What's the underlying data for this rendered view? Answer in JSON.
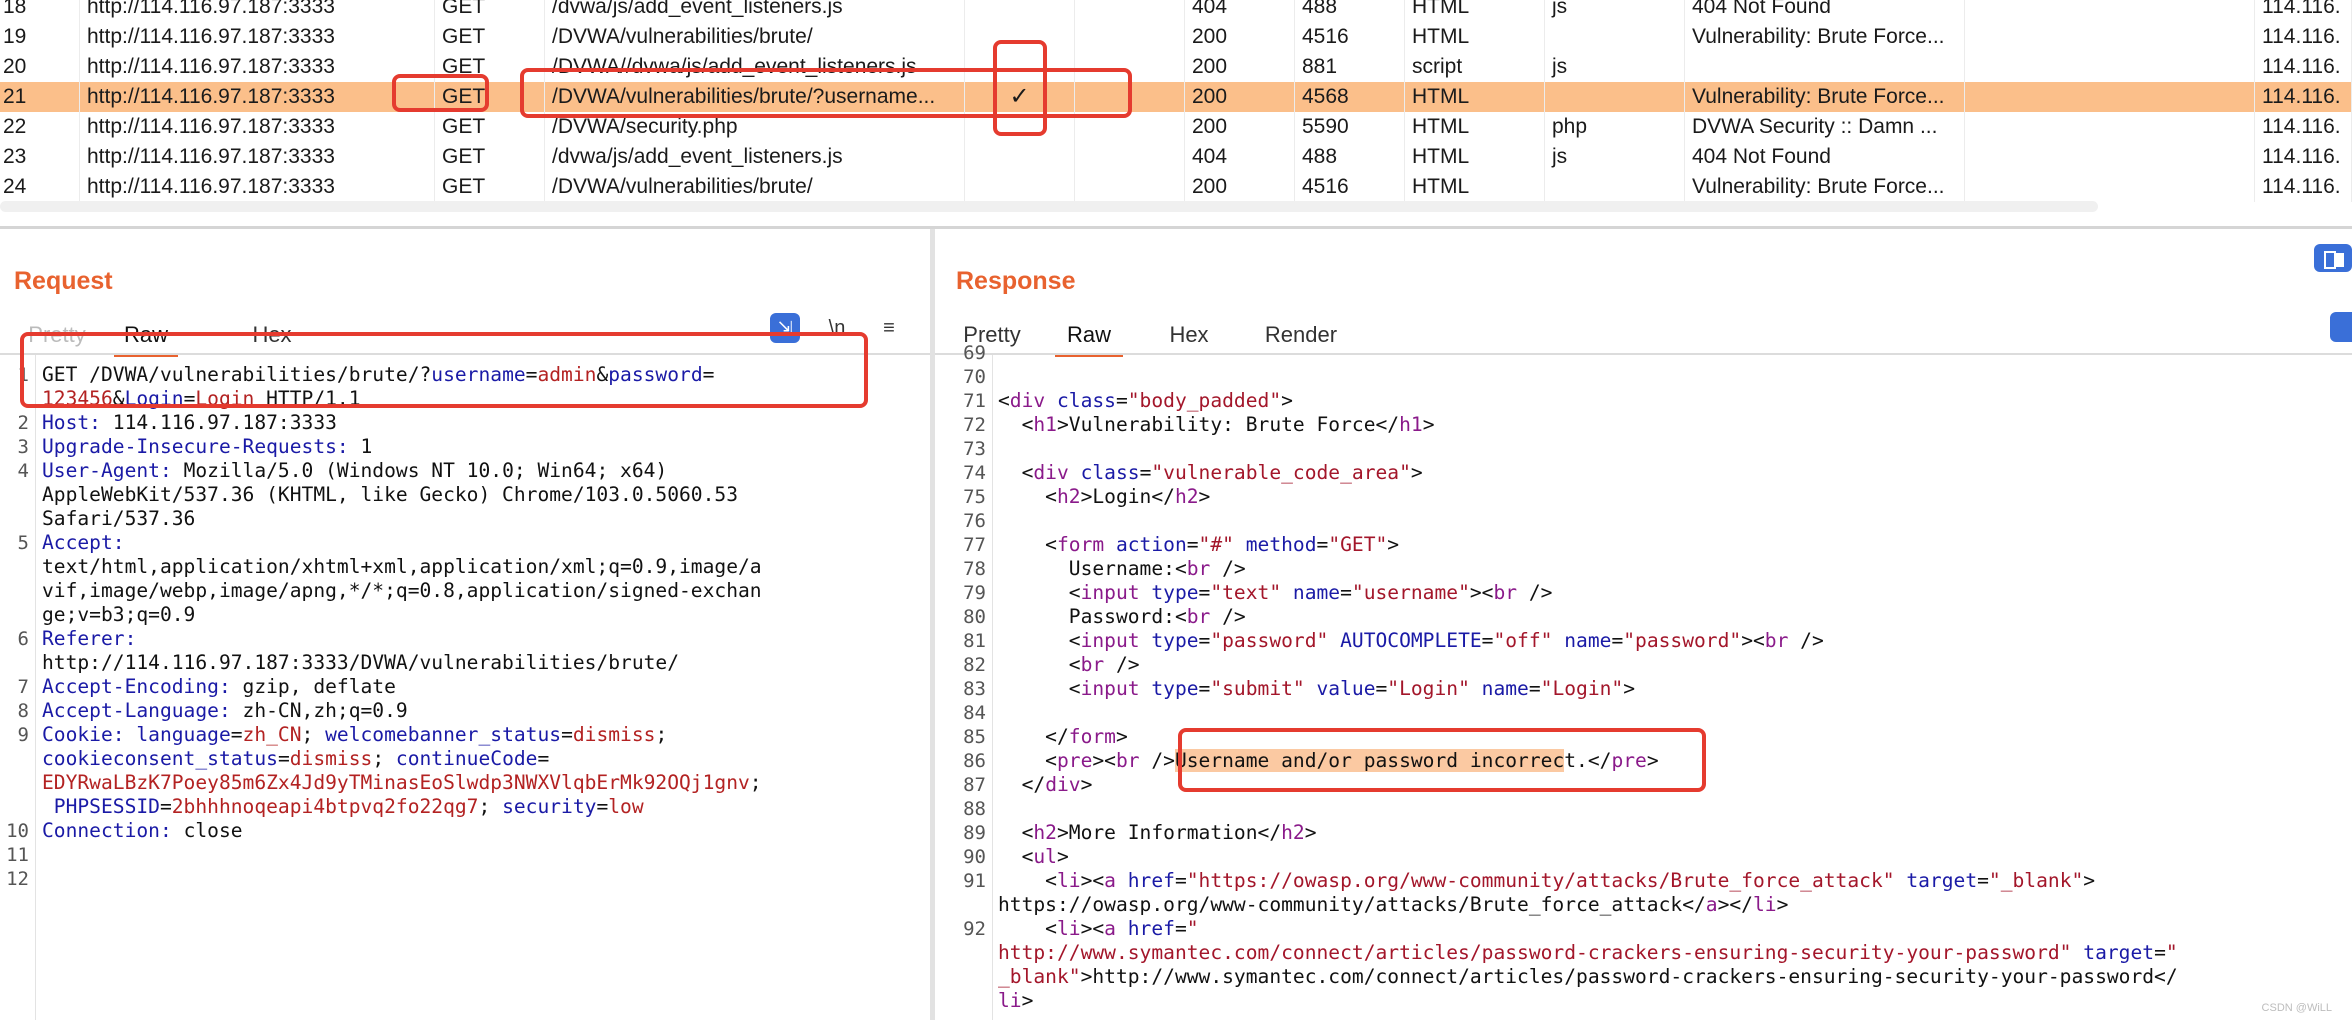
{
  "history": {
    "rows": [
      {
        "n": "18",
        "host": "http://114.116.97.187:3333",
        "method": "GET",
        "url": "/dvwa/js/add_event_listeners.js",
        "edited": "",
        "status": "404",
        "length": "488",
        "mime": "HTML",
        "ext": "js",
        "title": "404 Not Found",
        "ip": "114.116."
      },
      {
        "n": "19",
        "host": "http://114.116.97.187:3333",
        "method": "GET",
        "url": "/DVWA/vulnerabilities/brute/",
        "edited": "",
        "status": "200",
        "length": "4516",
        "mime": "HTML",
        "ext": "",
        "title": "Vulnerability: Brute Force...",
        "ip": "114.116."
      },
      {
        "n": "20",
        "host": "http://114.116.97.187:3333",
        "method": "GET",
        "url": "/DVWA//dvwa/js/add_event_listeners.js",
        "edited": "",
        "status": "200",
        "length": "881",
        "mime": "script",
        "ext": "js",
        "title": "",
        "ip": "114.116."
      },
      {
        "n": "21",
        "host": "http://114.116.97.187:3333",
        "method": "GET",
        "url": "/DVWA/vulnerabilities/brute/?username...",
        "edited": "✓",
        "status": "200",
        "length": "4568",
        "mime": "HTML",
        "ext": "",
        "title": "Vulnerability: Brute Force...",
        "ip": "114.116.",
        "selected": true
      },
      {
        "n": "22",
        "host": "http://114.116.97.187:3333",
        "method": "GET",
        "url": "/DVWA/security.php",
        "edited": "",
        "status": "200",
        "length": "5590",
        "mime": "HTML",
        "ext": "php",
        "title": "DVWA Security :: Damn ...",
        "ip": "114.116."
      },
      {
        "n": "23",
        "host": "http://114.116.97.187:3333",
        "method": "GET",
        "url": "/dvwa/js/add_event_listeners.js",
        "edited": "",
        "status": "404",
        "length": "488",
        "mime": "HTML",
        "ext": "js",
        "title": "404 Not Found",
        "ip": "114.116."
      },
      {
        "n": "24",
        "host": "http://114.116.97.187:3333",
        "method": "GET",
        "url": "/DVWA/vulnerabilities/brute/",
        "edited": "",
        "status": "200",
        "length": "4516",
        "mime": "HTML",
        "ext": "",
        "title": "Vulnerability: Brute Force...",
        "ip": "114.116."
      }
    ]
  },
  "request": {
    "title": "Request",
    "tabs": {
      "pretty": "Pretty",
      "raw": "Raw",
      "hex": "Hex"
    },
    "newline_label": "\\n",
    "menu_glyph": "≡",
    "lines": [
      {
        "n": "1",
        "parts": [
          [
            "plain",
            "GET /DVWA/vulnerabilities/brute/?"
          ],
          [
            "k",
            "username"
          ],
          [
            "plain",
            "="
          ],
          [
            "v",
            "admin"
          ],
          [
            "plain",
            "&"
          ],
          [
            "k",
            "password"
          ],
          [
            "plain",
            "="
          ]
        ]
      },
      {
        "n": "",
        "parts": [
          [
            "v",
            "123456"
          ],
          [
            "plain",
            "&"
          ],
          [
            "k",
            "Login"
          ],
          [
            "plain",
            "="
          ],
          [
            "v",
            "Login"
          ],
          [
            "plain",
            " HTTP/1.1"
          ]
        ]
      },
      {
        "n": "2",
        "parts": [
          [
            "k",
            "Host: "
          ],
          [
            "plain",
            "114.116.97.187:3333"
          ]
        ]
      },
      {
        "n": "3",
        "parts": [
          [
            "k",
            "Upgrade-Insecure-Requests: "
          ],
          [
            "plain",
            "1"
          ]
        ]
      },
      {
        "n": "4",
        "parts": [
          [
            "k",
            "User-Agent: "
          ],
          [
            "plain",
            "Mozilla/5.0 (Windows NT 10.0; Win64; x64)"
          ]
        ]
      },
      {
        "n": "",
        "parts": [
          [
            "plain",
            "AppleWebKit/537.36 (KHTML, like Gecko) Chrome/103.0.5060.53"
          ]
        ]
      },
      {
        "n": "",
        "parts": [
          [
            "plain",
            "Safari/537.36"
          ]
        ]
      },
      {
        "n": "5",
        "parts": [
          [
            "k",
            "Accept: "
          ]
        ]
      },
      {
        "n": "",
        "parts": [
          [
            "plain",
            "text/html,application/xhtml+xml,application/xml;q=0.9,image/a"
          ]
        ]
      },
      {
        "n": "",
        "parts": [
          [
            "plain",
            "vif,image/webp,image/apng,*/*;q=0.8,application/signed-exchan"
          ]
        ]
      },
      {
        "n": "",
        "parts": [
          [
            "plain",
            "ge;v=b3;q=0.9"
          ]
        ]
      },
      {
        "n": "6",
        "parts": [
          [
            "k",
            "Referer: "
          ]
        ]
      },
      {
        "n": "",
        "parts": [
          [
            "plain",
            "http://114.116.97.187:3333/DVWA/vulnerabilities/brute/"
          ]
        ]
      },
      {
        "n": "7",
        "parts": [
          [
            "k",
            "Accept-Encoding: "
          ],
          [
            "plain",
            "gzip, deflate"
          ]
        ]
      },
      {
        "n": "8",
        "parts": [
          [
            "k",
            "Accept-Language: "
          ],
          [
            "plain",
            "zh-CN,zh;q=0.9"
          ]
        ]
      },
      {
        "n": "9",
        "parts": [
          [
            "k",
            "Cookie: "
          ],
          [
            "k",
            "language"
          ],
          [
            "plain",
            "="
          ],
          [
            "v",
            "zh_CN"
          ],
          [
            "plain",
            "; "
          ],
          [
            "k",
            "welcomebanner_status"
          ],
          [
            "plain",
            "="
          ],
          [
            "v",
            "dismiss"
          ],
          [
            "plain",
            ";"
          ]
        ]
      },
      {
        "n": "",
        "parts": [
          [
            "k",
            "cookieconsent_status"
          ],
          [
            "plain",
            "="
          ],
          [
            "v",
            "dismiss"
          ],
          [
            "plain",
            "; "
          ],
          [
            "k",
            "continueCode"
          ],
          [
            "plain",
            "="
          ]
        ]
      },
      {
        "n": "",
        "parts": [
          [
            "v",
            "EDYRwaLBzK7Poey85m6Zx4Jd9yTMinasEoSlwdp3NWXVlqbErMk92OQj1gnv"
          ],
          [
            "plain",
            ";"
          ]
        ]
      },
      {
        "n": "",
        "parts": [
          [
            "plain",
            " "
          ],
          [
            "k",
            "PHPSESSID"
          ],
          [
            "plain",
            "="
          ],
          [
            "v",
            "2bhhhnoqeapi4btpvq2fo22qg7"
          ],
          [
            "plain",
            "; "
          ],
          [
            "k",
            "security"
          ],
          [
            "plain",
            "="
          ],
          [
            "v",
            "low"
          ]
        ]
      },
      {
        "n": "10",
        "parts": [
          [
            "k",
            "Connection: "
          ],
          [
            "plain",
            "close"
          ]
        ]
      },
      {
        "n": "11",
        "parts": []
      },
      {
        "n": "12",
        "parts": []
      }
    ]
  },
  "response": {
    "title": "Response",
    "tabs": {
      "pretty": "Pretty",
      "raw": "Raw",
      "hex": "Hex",
      "render": "Render"
    },
    "lines": [
      {
        "n": "69",
        "parts": []
      },
      {
        "n": "70",
        "parts": []
      },
      {
        "n": "71",
        "parts": [
          [
            "plain",
            "<"
          ],
          [
            "t",
            "div"
          ],
          [
            "plain",
            " "
          ],
          [
            "k",
            "class"
          ],
          [
            "plain",
            "="
          ],
          [
            "s",
            "\"body_padded\""
          ],
          [
            "plain",
            ">"
          ]
        ]
      },
      {
        "n": "72",
        "parts": [
          [
            "plain",
            "  <"
          ],
          [
            "t",
            "h1"
          ],
          [
            "plain",
            ">Vulnerability: Brute Force</"
          ],
          [
            "t",
            "h1"
          ],
          [
            "plain",
            ">"
          ]
        ]
      },
      {
        "n": "73",
        "parts": []
      },
      {
        "n": "74",
        "parts": [
          [
            "plain",
            "  <"
          ],
          [
            "t",
            "div"
          ],
          [
            "plain",
            " "
          ],
          [
            "k",
            "class"
          ],
          [
            "plain",
            "="
          ],
          [
            "s",
            "\"vulnerable_code_area\""
          ],
          [
            "plain",
            ">"
          ]
        ]
      },
      {
        "n": "75",
        "parts": [
          [
            "plain",
            "    <"
          ],
          [
            "t",
            "h2"
          ],
          [
            "plain",
            ">Login</"
          ],
          [
            "t",
            "h2"
          ],
          [
            "plain",
            ">"
          ]
        ]
      },
      {
        "n": "76",
        "parts": []
      },
      {
        "n": "77",
        "parts": [
          [
            "plain",
            "    <"
          ],
          [
            "t",
            "form"
          ],
          [
            "plain",
            " "
          ],
          [
            "k",
            "action"
          ],
          [
            "plain",
            "="
          ],
          [
            "s",
            "\"#\""
          ],
          [
            "plain",
            " "
          ],
          [
            "k",
            "method"
          ],
          [
            "plain",
            "="
          ],
          [
            "s",
            "\"GET\""
          ],
          [
            "plain",
            ">"
          ]
        ]
      },
      {
        "n": "78",
        "parts": [
          [
            "plain",
            "      Username:<"
          ],
          [
            "t",
            "br"
          ],
          [
            "plain",
            " />"
          ]
        ]
      },
      {
        "n": "79",
        "parts": [
          [
            "plain",
            "      <"
          ],
          [
            "t",
            "input"
          ],
          [
            "plain",
            " "
          ],
          [
            "k",
            "type"
          ],
          [
            "plain",
            "="
          ],
          [
            "s",
            "\"text\""
          ],
          [
            "plain",
            " "
          ],
          [
            "k",
            "name"
          ],
          [
            "plain",
            "="
          ],
          [
            "s",
            "\"username\""
          ],
          [
            "plain",
            "><"
          ],
          [
            "t",
            "br"
          ],
          [
            "plain",
            " />"
          ]
        ]
      },
      {
        "n": "80",
        "parts": [
          [
            "plain",
            "      Password:<"
          ],
          [
            "t",
            "br"
          ],
          [
            "plain",
            " />"
          ]
        ]
      },
      {
        "n": "81",
        "parts": [
          [
            "plain",
            "      <"
          ],
          [
            "t",
            "input"
          ],
          [
            "plain",
            " "
          ],
          [
            "k",
            "type"
          ],
          [
            "plain",
            "="
          ],
          [
            "s",
            "\"password\""
          ],
          [
            "plain",
            " "
          ],
          [
            "k",
            "AUTOCOMPLETE"
          ],
          [
            "plain",
            "="
          ],
          [
            "s",
            "\"off\""
          ],
          [
            "plain",
            " "
          ],
          [
            "k",
            "name"
          ],
          [
            "plain",
            "="
          ],
          [
            "s",
            "\"password\""
          ],
          [
            "plain",
            "><"
          ],
          [
            "t",
            "br"
          ],
          [
            "plain",
            " />"
          ]
        ]
      },
      {
        "n": "82",
        "parts": [
          [
            "plain",
            "      <"
          ],
          [
            "t",
            "br"
          ],
          [
            "plain",
            " />"
          ]
        ]
      },
      {
        "n": "83",
        "parts": [
          [
            "plain",
            "      <"
          ],
          [
            "t",
            "input"
          ],
          [
            "plain",
            " "
          ],
          [
            "k",
            "type"
          ],
          [
            "plain",
            "="
          ],
          [
            "s",
            "\"submit\""
          ],
          [
            "plain",
            " "
          ],
          [
            "k",
            "value"
          ],
          [
            "plain",
            "="
          ],
          [
            "s",
            "\"Login\""
          ],
          [
            "plain",
            " "
          ],
          [
            "k",
            "name"
          ],
          [
            "plain",
            "="
          ],
          [
            "s",
            "\"Login\""
          ],
          [
            "plain",
            ">"
          ]
        ]
      },
      {
        "n": "84",
        "parts": []
      },
      {
        "n": "85",
        "parts": [
          [
            "plain",
            "    </"
          ],
          [
            "t",
            "form"
          ],
          [
            "plain",
            ">"
          ]
        ]
      },
      {
        "n": "86",
        "parts": [
          [
            "plain",
            "    <"
          ],
          [
            "t",
            "pre"
          ],
          [
            "plain",
            "><"
          ],
          [
            "t",
            "br"
          ],
          [
            "plain",
            " />"
          ],
          [
            "hl",
            "Username and/or password incorrec"
          ],
          [
            "plain",
            "t.</"
          ],
          [
            "t",
            "pre"
          ],
          [
            "plain",
            ">"
          ]
        ]
      },
      {
        "n": "87",
        "parts": [
          [
            "plain",
            "  </"
          ],
          [
            "t",
            "div"
          ],
          [
            "plain",
            ">"
          ]
        ]
      },
      {
        "n": "88",
        "parts": []
      },
      {
        "n": "89",
        "parts": [
          [
            "plain",
            "  <"
          ],
          [
            "t",
            "h2"
          ],
          [
            "plain",
            ">More Information</"
          ],
          [
            "t",
            "h2"
          ],
          [
            "plain",
            ">"
          ]
        ]
      },
      {
        "n": "90",
        "parts": [
          [
            "plain",
            "  <"
          ],
          [
            "t",
            "ul"
          ],
          [
            "plain",
            ">"
          ]
        ]
      },
      {
        "n": "91",
        "parts": [
          [
            "plain",
            "    <"
          ],
          [
            "t",
            "li"
          ],
          [
            "plain",
            "><"
          ],
          [
            "t",
            "a"
          ],
          [
            "plain",
            " "
          ],
          [
            "k",
            "href"
          ],
          [
            "plain",
            "="
          ],
          [
            "s",
            "\"https://owasp.org/www-community/attacks/Brute_force_attack\""
          ],
          [
            "plain",
            " "
          ],
          [
            "k",
            "target"
          ],
          [
            "plain",
            "="
          ],
          [
            "s",
            "\"_blank\""
          ],
          [
            "plain",
            ">"
          ]
        ]
      },
      {
        "n": "",
        "parts": [
          [
            "plain",
            "https://owasp.org/www-community/attacks/Brute_force_attack</"
          ],
          [
            "t",
            "a"
          ],
          [
            "plain",
            "></"
          ],
          [
            "t",
            "li"
          ],
          [
            "plain",
            ">"
          ]
        ]
      },
      {
        "n": "92",
        "parts": [
          [
            "plain",
            "    <"
          ],
          [
            "t",
            "li"
          ],
          [
            "plain",
            "><"
          ],
          [
            "t",
            "a"
          ],
          [
            "plain",
            " "
          ],
          [
            "k",
            "href"
          ],
          [
            "plain",
            "="
          ],
          [
            "s",
            "\""
          ]
        ]
      },
      {
        "n": "",
        "parts": [
          [
            "s",
            "http://www.symantec.com/connect/articles/password-crackers-ensuring-security-your-password\""
          ],
          [
            "plain",
            " "
          ],
          [
            "k",
            "target"
          ],
          [
            "plain",
            "="
          ],
          [
            "s",
            "\""
          ]
        ]
      },
      {
        "n": "",
        "parts": [
          [
            "s",
            "_blank\""
          ],
          [
            "plain",
            ">http://www.symantec.com/connect/articles/password-crackers-ensuring-security-your-password</"
          ]
        ]
      },
      {
        "n": "",
        "parts": [
          [
            "t",
            "li"
          ],
          [
            "plain",
            ">"
          ]
        ]
      }
    ]
  },
  "watermark": "CSDN @WiLL"
}
